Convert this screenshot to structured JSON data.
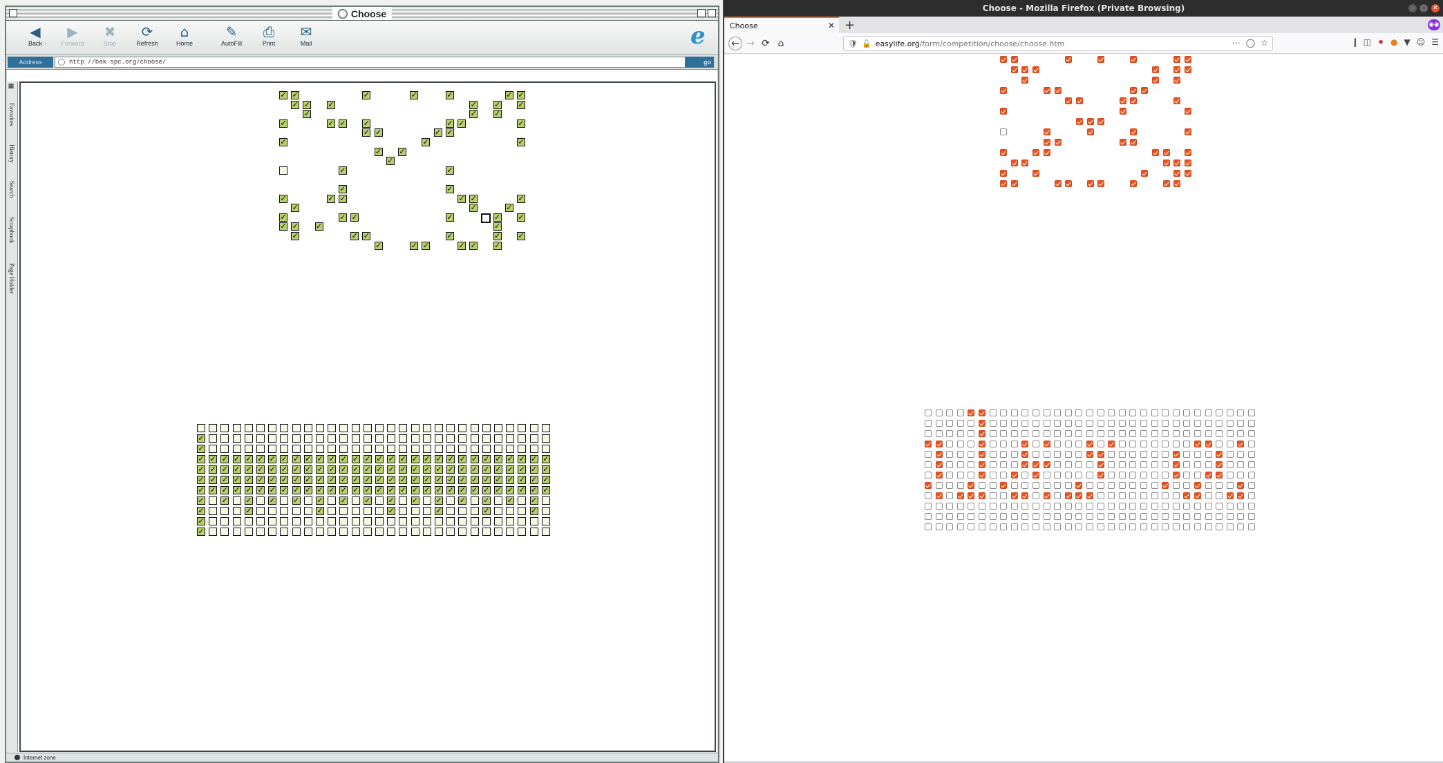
{
  "ie": {
    "window_title": "Choose",
    "toolbar": {
      "back": "Back",
      "forward": "Forward",
      "stop": "Stop",
      "refresh": "Refresh",
      "home": "Home",
      "autofill": "AutoFill",
      "print": "Print",
      "mail": "Mail"
    },
    "address_label": "Address",
    "address_url": "http  //bak spc.org/choose/",
    "go_label": "go",
    "sidebar_tabs": [
      "Favorites",
      "History",
      "Search",
      "Scrapbook",
      "Page Holder"
    ],
    "status_text": "Internet zone",
    "top_grid": {
      "rows": [
        "YYOOOOOYOOOYOOYOOOOYY",
        "OYYOYOOOOOOOOOOOYOYOY",
        "OOYOOOOOOOOOOOOOYOYOO",
        "YOOOYYOYOOOOOOYYOOOOY",
        "OOOOOOOYYOOOOYYOOOOOO",
        "YOOOOOOOOOOOYOOOOOOOY",
        "OOOOOOOOYOYOOOOOOOOOO",
        "OOOOOOOOOYOOOOOOOOOOO",
        "NOOOOYOOOOOOOOYOOOOOO",
        "OOOOOOOOOOOOOOOOOOOOO",
        "OOOOOYOOOOOOOOYOOOOOO",
        "YOOOYYOOOOOOOOOYYOOOY",
        "OYOOOOOOOOOOOOOOYOOYO",
        "YOOOOYYOOOOOOOYOOFYOY",
        "YYOYOOOOOOOOOOOOOOYOO",
        "OYOOOOYYOOOOOOYOOOYOY",
        "OOOOOOOOYOOYYOOYYOYOO"
      ],
      "legend": "Y = checked, N = unchecked, F = unchecked with focus ring, O = empty space"
    },
    "bottom_grid": {
      "rows": [
        "NNNNNNNNNNNNNNNNNNNNNNNNNNNNNN",
        "YNNNNNNNNNNNNNNNNNNNNNNNNNNNNN",
        "YNNNNNNNNNNNNNNNNNNNNNNNNNNNNN",
        "YYYYYYYYYYYYYYYYYYYYYYYYYYYYYY",
        "YYYYYYYYYYYYYYYYYYYYYYYYYYYYYY",
        "YYYYYYYYYYYYYYYYYYYYYYYYYYYYYY",
        "YYYYYYYYYYYYYYYYYYYYYYYYYYYYYY",
        "YNYNYNYNYNYNYNYNYNYNYNYNYNYNYN",
        "YNNNYNNNNNYNNNNNYNNNYNNNYNNNYN",
        "YNNNNNNNNNNNNNNNNNNNNNNNNNNNNN",
        "YNNNNNNNNNNNNNNNNNNNNNNNNNNNNN"
      ]
    }
  },
  "ff": {
    "window_title": "Choose - Mozilla Firefox (Private Browsing)",
    "tab_title": "Choose",
    "url_domain": "easylife.org",
    "url_path": "/form/competition/choose/choose.htm",
    "top_grid": {
      "rows": [
        "YYOOOOYOOYOOYOOOYY",
        "OYYYOOOOOOOOOOYOYY",
        "OOYOOOOOOOOOOOYOYO",
        "YOOOYYOOOOOOYYOOOO",
        "OOOOOOYYOOOYYOOOYO",
        "YOOOOOOOOOOYOOOOOY",
        "OOOOOOOYYYOOOOOOOO",
        "NOOOYOOOYOOOYOOOOY",
        "OOOOYYOOOOOYYOOOOO",
        "YOOYYOOOOOOOOOYYOY",
        "OYYOOOOOOOOOOOOYYY",
        "YOOYOOOOOOOOOYOOYY",
        "YYOOOYYOYYOOYOOYYO"
      ],
      "legend": "Y = checked, N = unchecked, O = empty space"
    },
    "bottom_grid": {
      "rows": [
        "NNNNYYNNNNNNNNNNNNNNNNNNNNNNNNN",
        "NNNNNYNNNNNNNNNNNNNNNNNNNNNNNNN",
        "NNNNNYNNNNNNNNNNNNNNNNNNNNNNNNN",
        "YYNNNYNNNYNYNNNYNYNNNNNNNYYNNYN",
        "NYNNNYNNNYNNNNNYYNNNNNNYNNNYNNN",
        "NYNNNYNNNYYYNNNNYNNNNNNYNNNYNNN",
        "NYNNNYNNYNYNNNNNYNNNNNNYNNYYNNN",
        "YNNNYNNYNNNNNNYNNNNNNNYNNYNNNYN",
        "NYNYYYNNYYNYNYYYNNNNNNNNYYNNYYN",
        "NNNNNNNNNNNNNNNNNNNNNNNNNNNNNNN",
        "NNNNNNNNNNNNNNNNNNNNNNNNNNNNNNN",
        "NNNNNNNNNNNNNNNNNNNNNNNNNNNNNNN"
      ]
    }
  }
}
